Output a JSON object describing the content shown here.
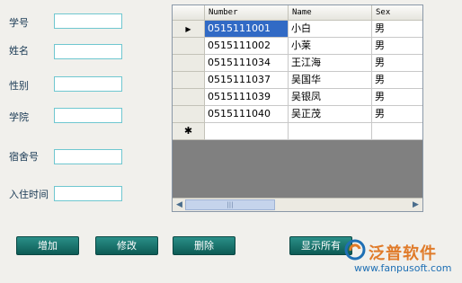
{
  "form": {
    "fields": [
      {
        "label": "学号",
        "value": ""
      },
      {
        "label": "姓名",
        "value": ""
      },
      {
        "label": "性别",
        "value": ""
      },
      {
        "label": "学院",
        "value": ""
      },
      {
        "label": "宿舍号",
        "value": ""
      },
      {
        "label": "入住时间",
        "value": ""
      }
    ]
  },
  "grid": {
    "columns": [
      "Number",
      "Name",
      "Sex"
    ],
    "rows": [
      {
        "indicator": "▶",
        "number": "0515111001",
        "name": "小白",
        "sex": "男"
      },
      {
        "indicator": "",
        "number": "0515111002",
        "name": "小莱",
        "sex": "男"
      },
      {
        "indicator": "",
        "number": "0515111034",
        "name": "王江海",
        "sex": "男"
      },
      {
        "indicator": "",
        "number": "0515111037",
        "name": "吴国华",
        "sex": "男"
      },
      {
        "indicator": "",
        "number": "0515111039",
        "name": "吴银凤",
        "sex": "男"
      },
      {
        "indicator": "",
        "number": "0515111040",
        "name": "吴正茂",
        "sex": "男"
      }
    ],
    "new_row_indicator": "✱",
    "scroll_left": "◀",
    "scroll_right": "▶",
    "thumb_grip": "|||"
  },
  "buttons": {
    "add": "增加",
    "edit": "修改",
    "delete": "删除",
    "show_all": "显示所有"
  },
  "watermark": {
    "name": "泛普软件",
    "url": "www.fanpusoft.com"
  }
}
